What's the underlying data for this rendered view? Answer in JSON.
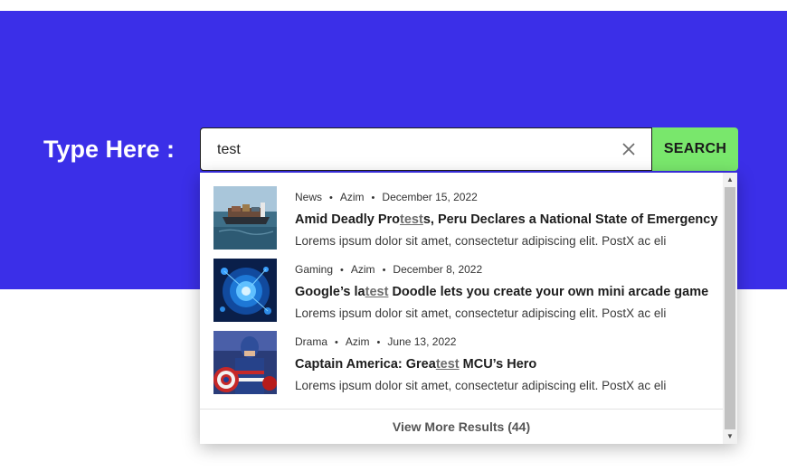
{
  "hero": {
    "background_color": "#3b2fe8",
    "label": "Type Here :"
  },
  "search": {
    "value": "test",
    "placeholder": "",
    "clear_icon": "close-icon",
    "button_label": "SEARCH",
    "button_color": "#79e76c"
  },
  "results": [
    {
      "category": "News",
      "author": "Azim",
      "date": "December 15, 2022",
      "title_before": "Amid Deadly Pro",
      "title_match": "test",
      "title_after": "s, Peru Declares a National State of Emergency",
      "excerpt": "Lorems ipsum dolor sit amet, consectetur adipiscing elit. PostX ac eli",
      "thumbnail": "cargo-ship-image"
    },
    {
      "category": "Gaming",
      "author": "Azim",
      "date": "December 8, 2022",
      "title_before": "Google’s la",
      "title_match": "test",
      "title_after": " Doodle lets you create your own mini arcade game",
      "excerpt": "Lorems ipsum dolor sit amet, consectetur adipiscing elit. PostX ac eli",
      "thumbnail": "blue-tech-image"
    },
    {
      "category": "Drama",
      "author": "Azim",
      "date": "June 13, 2022",
      "title_before": "Captain America: Grea",
      "title_match": "test",
      "title_after": " MCU’s Hero",
      "excerpt": "Lorems ipsum dolor sit amet, consectetur adipiscing elit. PostX ac eli",
      "thumbnail": "captain-america-image"
    }
  ],
  "footer": {
    "view_more_label": "View More Results (44)"
  },
  "separator": "•"
}
